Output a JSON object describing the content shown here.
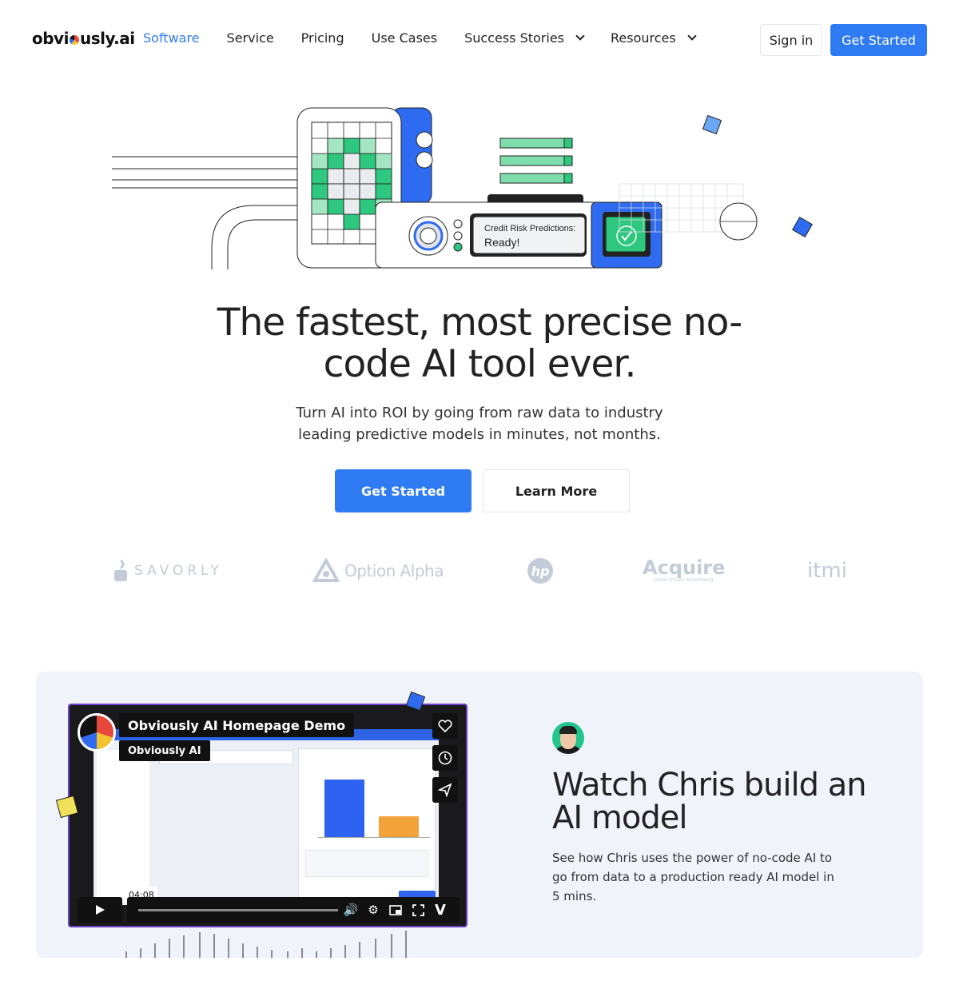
{
  "nav": {
    "logo": {
      "prefix": "obvi",
      "suffix": "usly.ai"
    },
    "items": [
      {
        "label": "Software",
        "active": true
      },
      {
        "label": "Service",
        "active": false
      },
      {
        "label": "Pricing",
        "active": false
      },
      {
        "label": "Use Cases",
        "active": false
      },
      {
        "label": "Success Stories",
        "active": false,
        "dropdown": true
      },
      {
        "label": "Resources",
        "active": false,
        "dropdown": true
      }
    ],
    "sign_in": "Sign in",
    "get_started": "Get Started"
  },
  "hero": {
    "illustration": {
      "status_label": "Credit Risk Predictions:",
      "status_value": "Ready!"
    },
    "title": "The fastest, most precise no-code AI tool ever.",
    "subtitle": "Turn AI into ROI by going from raw data to industry leading predictive models in minutes, not months.",
    "primary_cta": "Get Started",
    "secondary_cta": "Learn More"
  },
  "clients": [
    {
      "name": "SAVORLY"
    },
    {
      "name": "Option Alpha"
    },
    {
      "name": "hp"
    },
    {
      "name": "Acquire",
      "tagline": "Done-Driven Advertising"
    },
    {
      "name": "itmi"
    }
  ],
  "demo": {
    "video": {
      "title": "Obviously AI Homepage Demo",
      "channel": "Obviously AI",
      "duration": "04:08"
    },
    "title": "Watch Chris build an AI model",
    "description": "See how Chris uses the power of no-code AI to go from data to a production ready AI model in 5 mins."
  },
  "colors": {
    "accent": "#2f7bf3",
    "section_bg": "#f1f3fb",
    "green": "#22c58b"
  }
}
